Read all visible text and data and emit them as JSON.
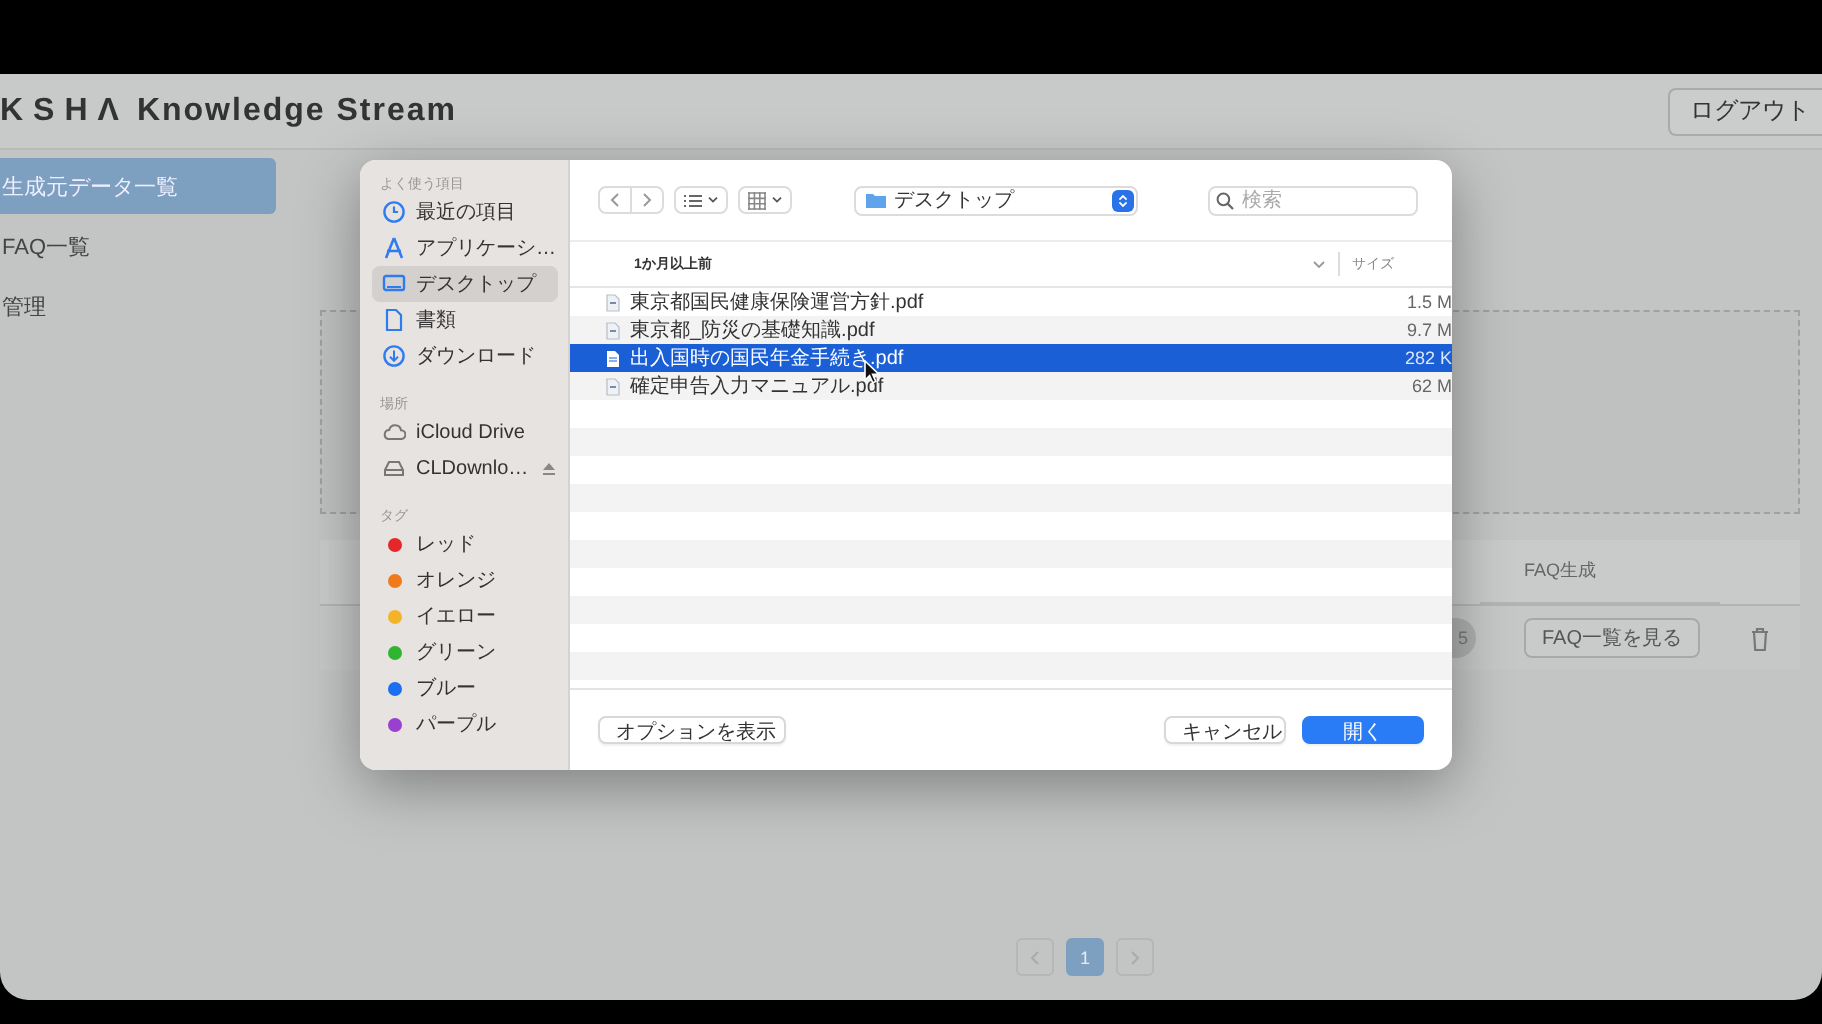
{
  "app_header": {
    "logo_mark": "KSHΛ",
    "title": "Knowledge Stream",
    "logout_button": "ログアウト"
  },
  "nav": {
    "items": [
      {
        "label": "生成元データ一覧",
        "selected": true
      },
      {
        "label": "FAQ一覧",
        "selected": false
      },
      {
        "label": "管理",
        "selected": false
      }
    ]
  },
  "table": {
    "columns": [
      "FAQ生成"
    ],
    "rows": [
      {
        "status_badge": "5",
        "faq_button": "FAQ一覧を見る"
      }
    ]
  },
  "pagination": {
    "pages": [
      {
        "label": "1",
        "selected": true
      }
    ]
  },
  "dialog": {
    "sidebar": {
      "sections": [
        {
          "title": "よく使う項目",
          "items": [
            {
              "label": "最近の項目",
              "kind": "recent",
              "selected": false
            },
            {
              "label": "アプリケーシ…",
              "kind": "apps",
              "selected": false
            },
            {
              "label": "デスクトップ",
              "kind": "desktop",
              "selected": true
            },
            {
              "label": "書類",
              "kind": "document",
              "selected": false
            },
            {
              "label": "ダウンロード",
              "kind": "download",
              "selected": false
            }
          ]
        },
        {
          "title": "場所",
          "items": [
            {
              "label": "iCloud Drive",
              "kind": "cloud",
              "selected": false
            },
            {
              "label": "CLDownlo…",
              "kind": "drive",
              "selected": false
            }
          ]
        },
        {
          "title": "タグ",
          "items": [
            {
              "label": "レッド",
              "kind": "tag",
              "color": "#e5262b",
              "selected": false
            },
            {
              "label": "オレンジ",
              "kind": "tag",
              "color": "#f07a1a",
              "selected": false
            },
            {
              "label": "イエロー",
              "kind": "tag",
              "color": "#f3b42a",
              "selected": false
            },
            {
              "label": "グリーン",
              "kind": "tag",
              "color": "#2fb52f",
              "selected": false
            },
            {
              "label": "ブルー",
              "kind": "tag",
              "color": "#1d6ef0",
              "selected": false
            },
            {
              "label": "パープル",
              "kind": "tag",
              "color": "#9a3fd0",
              "selected": false
            }
          ]
        }
      ]
    },
    "location": "デスクトップ",
    "search": {
      "placeholder": "検索"
    },
    "columns": [
      "1か月以上前",
      "サイズ"
    ],
    "files": [
      {
        "name": "東京都国民健康保険運営方針.pdf",
        "size": "1.5 M",
        "selected": false
      },
      {
        "name": "東京都_防災の基礎知識.pdf",
        "size": "9.7 M",
        "selected": false
      },
      {
        "name": "出入国時の国民年金手続き.pdf",
        "size": "282 K",
        "selected": true
      },
      {
        "name": "確定申告入力マニュアル.pdf",
        "size": "62 M",
        "selected": false
      }
    ],
    "buttons": [
      {
        "label": "オプションを表示",
        "kind": "secondary"
      },
      {
        "label": "キャンセル",
        "kind": "secondary"
      },
      {
        "label": "開く",
        "kind": "primary"
      }
    ]
  }
}
